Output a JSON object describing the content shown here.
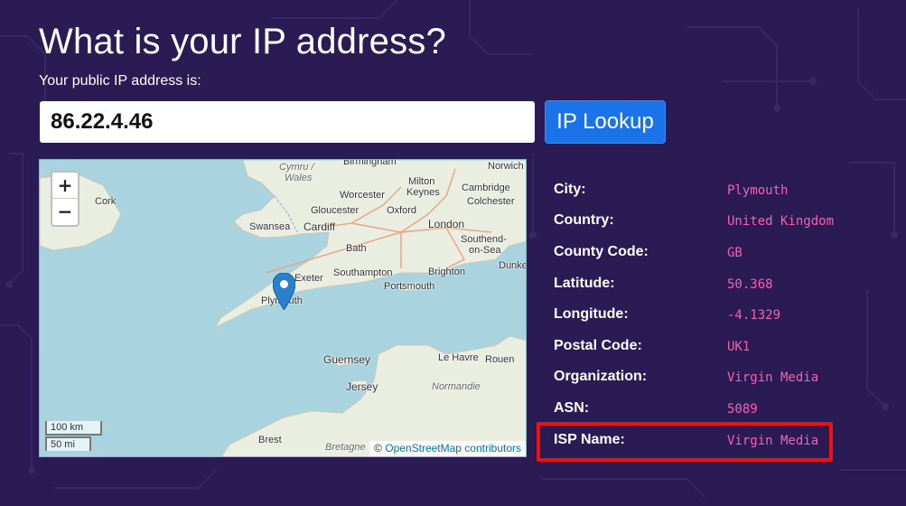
{
  "page": {
    "title": "What is your IP address?",
    "subtitle": "Your public IP address is:"
  },
  "search": {
    "ip_value": "86.22.4.46",
    "button_label": "IP Lookup"
  },
  "map": {
    "zoom_in": "+",
    "zoom_out": "−",
    "scale_km": "100 km",
    "scale_mi": "50 mi",
    "attribution_prefix": "©",
    "attribution_link": "OpenStreetMap contributors",
    "labels": {
      "birmingham": "Birmingham",
      "norwich": "Norwich",
      "cymru": "Cymru /",
      "wales": "Wales",
      "milton_keynes_1": "Milton",
      "milton_keynes_2": "Keynes",
      "cambridge": "Cambridge",
      "cork": "Cork",
      "worcester": "Worcester",
      "colchester": "Colchester",
      "gloucester": "Gloucester",
      "oxford": "Oxford",
      "swansea": "Swansea",
      "cardiff": "Cardiff",
      "london": "London",
      "southend_1": "Southend-",
      "southend_2": "on-Sea",
      "bath": "Bath",
      "dunkerque": "Dunke",
      "exeter": "Exeter",
      "southampton": "Southampton",
      "brighton": "Brighton",
      "portsmouth": "Portsmouth",
      "plymouth": "Plymouth",
      "guernsey": "Guernsey",
      "le_havre": "Le Havre",
      "rouen": "Rouen",
      "jersey": "Jersey",
      "normandie": "Normandie",
      "brest": "Brest",
      "bretagne": "Bretagne"
    }
  },
  "info": {
    "rows": [
      {
        "key": "City:",
        "value": "Plymouth"
      },
      {
        "key": "Country:",
        "value": "United Kingdom"
      },
      {
        "key": "County Code:",
        "value": "GB"
      },
      {
        "key": "Latitude:",
        "value": "50.368"
      },
      {
        "key": "Longitude:",
        "value": "-4.1329"
      },
      {
        "key": "Postal Code:",
        "value": "UK1"
      },
      {
        "key": "Organization:",
        "value": "Virgin Media"
      },
      {
        "key": "ASN:",
        "value": "5089"
      },
      {
        "key": "ISP Name:",
        "value": "Virgin Media"
      }
    ]
  },
  "colors": {
    "background": "#2a1b55",
    "value_text": "#ff5cb0",
    "button": "#1a73e8",
    "highlight": "#ee1111"
  }
}
